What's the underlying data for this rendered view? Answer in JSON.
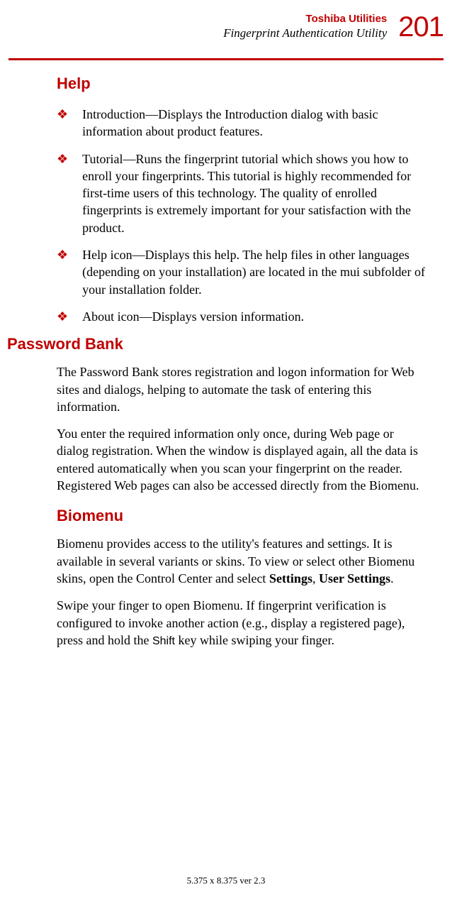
{
  "header": {
    "title": "Toshiba Utilities",
    "subtitle": "Fingerprint Authentication Utility",
    "page_number": "201"
  },
  "help": {
    "heading": "Help",
    "items": [
      "Introduction—Displays the Introduction dialog with basic information about product features.",
      "Tutorial—Runs the fingerprint tutorial which shows you how to enroll your fingerprints. This tutorial is highly recommended for first-time users of this technology. The quality of enrolled fingerprints is extremely important for your satisfaction with the product.",
      "Help icon—Displays this help. The help files in other languages (depending on your installation) are located in the mui subfolder of your installation folder.",
      "About icon—Displays version information."
    ]
  },
  "password_bank": {
    "heading": "Password Bank",
    "para1": "The Password Bank stores registration and logon information for Web sites and dialogs, helping to automate the task of entering this information.",
    "para2": "You enter the required information only once, during Web page or dialog registration. When the window is displayed again, all the data is entered automatically when you scan your fingerprint on the reader. Registered Web pages can also be accessed directly from the Biomenu."
  },
  "biomenu": {
    "heading": "Biomenu",
    "para1_part1": "Biomenu provides access to the utility's features and settings. It is available in several variants or skins. To view or select other Biomenu skins, open the Control Center and select ",
    "para1_bold1": "Settings",
    "para1_sep": ", ",
    "para1_bold2": "User Settings",
    "para1_end": ".",
    "para2_part1": "Swipe your finger to open Biomenu. If fingerprint verification is configured to invoke another action (e.g., display a registered page), press and hold the ",
    "para2_key": "Shift",
    "para2_part2": " key while swiping your finger."
  },
  "footer": "5.375 x 8.375 ver 2.3"
}
